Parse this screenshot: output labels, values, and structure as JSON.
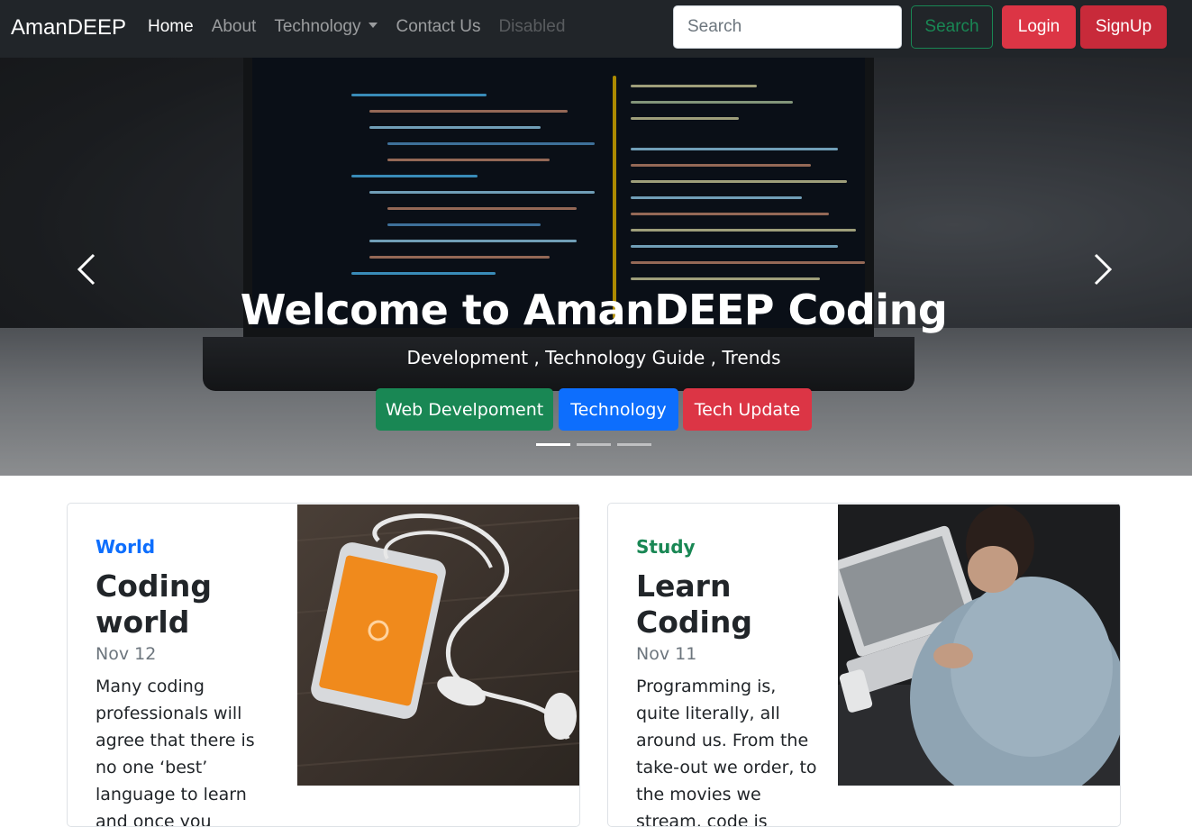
{
  "navbar": {
    "brand": "AmanDEEP",
    "links": [
      {
        "label": "Home"
      },
      {
        "label": "About"
      },
      {
        "label": "Technology"
      },
      {
        "label": "Contact Us"
      },
      {
        "label": "Disabled"
      }
    ],
    "search_placeholder": "Search",
    "search_button": "Search",
    "login_button": "Login",
    "signup_button": "SignUp"
  },
  "hero": {
    "title": "Welcome to AmanDEEP Coding",
    "subtitle": "Development , Technology Guide , Trends",
    "buttons": [
      {
        "label": "Web Develpoment"
      },
      {
        "label": "Technology"
      },
      {
        "label": "Tech Update"
      }
    ],
    "active_slide": 1,
    "slide_count": 3
  },
  "cards": [
    {
      "category": "World",
      "category_color": "#0d6efd",
      "title": "Coding world",
      "date": "Nov 12",
      "text": "Many coding professionals will agree that there is no one ‘best’ language to learn and once you"
    },
    {
      "category": "Study",
      "category_color": "#198754",
      "title": "Learn Coding",
      "date": "Nov 11",
      "text": "Programming is, quite literally, all around us. From the take-out we order, to the movies we stream, code is"
    }
  ],
  "colors": {
    "navbar_bg": "#212529",
    "success": "#198754",
    "primary": "#0d6efd",
    "danger": "#dc3545"
  }
}
